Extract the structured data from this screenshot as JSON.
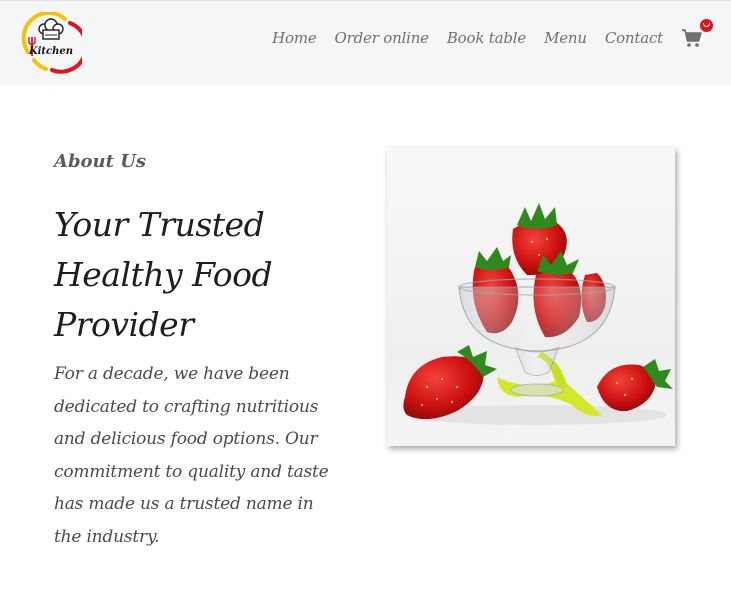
{
  "header": {
    "logo_text": "Kitchen",
    "nav": [
      {
        "label": "Home"
      },
      {
        "label": "Order online"
      },
      {
        "label": "Book table"
      },
      {
        "label": "Menu"
      },
      {
        "label": "Contact"
      }
    ],
    "cart_icon": "shopping-cart-icon",
    "badge_icon": "check-badge-icon"
  },
  "about": {
    "label": "About Us",
    "headline_lines": [
      "Your Trusted",
      "Healthy Food",
      "Provider"
    ],
    "description_lines": [
      "For a decade, we have been",
      "dedicated to crafting nutritious",
      "and delicious food options. Our",
      "commitment to quality and taste",
      "has made us a trusted name in",
      "the industry."
    ]
  },
  "colors": {
    "header_bg": "#f5f6f8",
    "badge": "#e3121b",
    "logo_yellow": "#f5c400",
    "logo_red": "#e3121b"
  }
}
